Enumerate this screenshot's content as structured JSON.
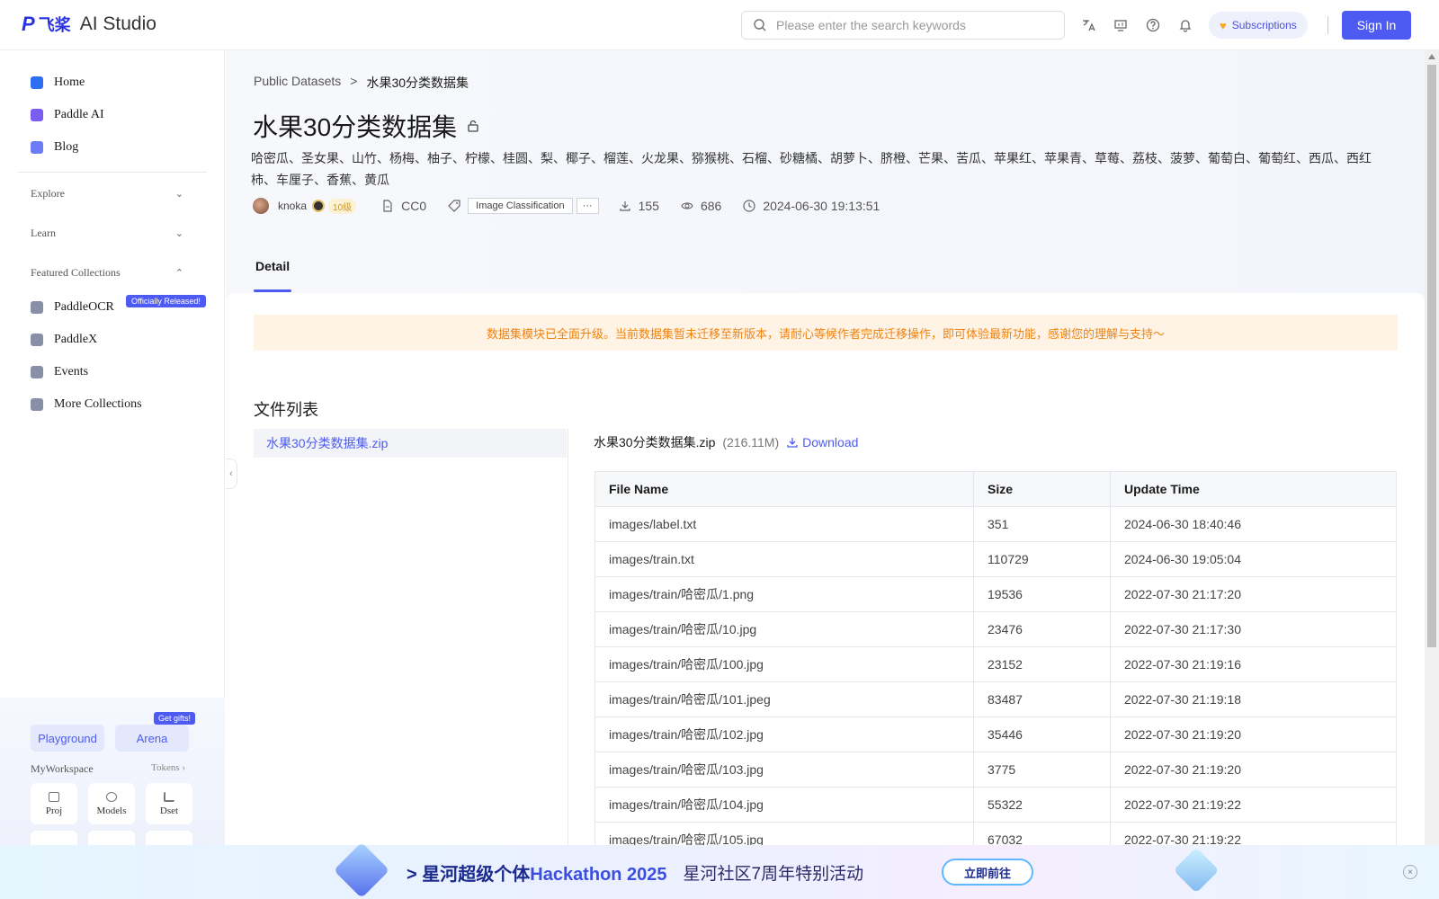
{
  "app": {
    "logo_mark": "P",
    "logo_cn": "飞桨",
    "name": "AI Studio"
  },
  "topbar": {
    "search_placeholder": "Please enter the search keywords",
    "subscriptions_label": "Subscriptions",
    "signin_label": "Sign In",
    "icons": [
      "translate-icon",
      "monitor-icon",
      "help-icon",
      "bell-icon"
    ]
  },
  "sidebar": {
    "items": [
      {
        "label": "Home",
        "icon": "home-icon",
        "color": "#2f6ef0"
      },
      {
        "label": "Paddle AI",
        "icon": "paddle-ai-icon",
        "color": "#7b5cf0"
      },
      {
        "label": "Blog",
        "icon": "blog-icon",
        "color": "#6d7cf5"
      }
    ],
    "groups": {
      "explore": "Explore",
      "learn": "Learn",
      "featured": "Featured Collections"
    },
    "featured_items": [
      {
        "label": "PaddleOCR",
        "icon": "paddleocr-icon"
      },
      {
        "label": "PaddleX",
        "icon": "paddlex-icon"
      },
      {
        "label": "Events",
        "icon": "events-icon"
      },
      {
        "label": "More Collections",
        "icon": "more-collections-icon"
      }
    ],
    "released_badge": "Officially Released!",
    "bottom": {
      "playground": "Playground",
      "arena": "Arena",
      "gift_badge": "Get gifts!",
      "workspace": "MyWorkspace",
      "tokens": "Tokens",
      "tiles": [
        "Proj",
        "Models",
        "Dset"
      ]
    }
  },
  "breadcrumb": {
    "parent": "Public Datasets",
    "separator": ">",
    "current": "水果30分类数据集"
  },
  "dataset": {
    "title": "水果30分类数据集",
    "description": "哈密瓜、圣女果、山竹、杨梅、柚子、柠檬、桂圆、梨、椰子、榴莲、火龙果、猕猴桃、石榴、砂糖橘、胡萝卜、脐橙、芒果、苦瓜、苹果红、苹果青、草莓、荔枝、菠萝、葡萄白、葡萄红、西瓜、西红柿、车厘子、香蕉、黄瓜",
    "author": "knoka",
    "author_level": "10级",
    "license": "CC0",
    "tag": "Image Classification",
    "tag_more": "···",
    "downloads": "155",
    "views": "686",
    "updated": "2024-06-30 19:13:51"
  },
  "tabs": {
    "detail": "Detail"
  },
  "notice": "数据集模块已全面升级。当前数据集暂未迁移至新版本，请耐心等候作者完成迁移操作，即可体验最新功能，感谢您的理解与支持～",
  "files": {
    "section_title": "文件列表",
    "list": [
      "水果30分类数据集.zip"
    ],
    "selected_name": "水果30分类数据集.zip",
    "selected_size": "(216.11M)",
    "download_label": "Download",
    "columns": [
      "File Name",
      "Size",
      "Update Time"
    ],
    "rows": [
      [
        "images/label.txt",
        "351",
        "2024-06-30 18:40:46"
      ],
      [
        "images/train.txt",
        "110729",
        "2024-06-30 19:05:04"
      ],
      [
        "images/train/哈密瓜/1.png",
        "19536",
        "2022-07-30 21:17:20"
      ],
      [
        "images/train/哈密瓜/10.jpg",
        "23476",
        "2022-07-30 21:17:30"
      ],
      [
        "images/train/哈密瓜/100.jpg",
        "23152",
        "2022-07-30 21:19:16"
      ],
      [
        "images/train/哈密瓜/101.jpeg",
        "83487",
        "2022-07-30 21:19:18"
      ],
      [
        "images/train/哈密瓜/102.jpg",
        "35446",
        "2022-07-30 21:19:20"
      ],
      [
        "images/train/哈密瓜/103.jpg",
        "3775",
        "2022-07-30 21:19:20"
      ],
      [
        "images/train/哈密瓜/104.jpg",
        "55322",
        "2022-07-30 21:19:22"
      ],
      [
        "images/train/哈密瓜/105.jpg",
        "67032",
        "2022-07-30 21:19:22"
      ]
    ]
  },
  "banner": {
    "prefix": ">",
    "headline": "星河超级个体",
    "hackathon": "Hackathon 2025",
    "subline": "星河社区7周年特别活动",
    "button": "立即前往",
    "close": "×"
  },
  "colors": {
    "accent": "#4e5bf2",
    "notice_bg": "#fff3e6",
    "notice_text": "#f0830f"
  }
}
